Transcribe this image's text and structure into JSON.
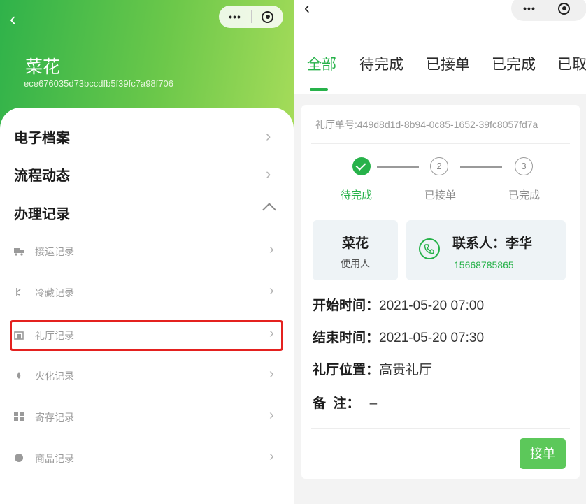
{
  "left": {
    "back_glyph": "‹",
    "user_name": "菜花",
    "user_id": "ece676035d73bccdfb5f39fc7a98f706",
    "menu": [
      {
        "label": "电子档案",
        "chevron": "›"
      },
      {
        "label": "流程动态",
        "chevron": "›"
      },
      {
        "label": "办理记录"
      }
    ],
    "records": [
      {
        "label": "接运记录",
        "icon": "truck-icon",
        "chevron": "›"
      },
      {
        "label": "冷藏记录",
        "icon": "snowflake-icon",
        "chevron": "›"
      },
      {
        "label": "礼厅记录",
        "icon": "hall-icon",
        "chevron": "›"
      },
      {
        "label": "火化记录",
        "icon": "flame-icon",
        "chevron": "›"
      },
      {
        "label": "寄存记录",
        "icon": "storage-icon",
        "chevron": "›"
      },
      {
        "label": "商品记录",
        "icon": "goods-icon",
        "chevron": "›"
      }
    ],
    "highlight_color": "#e4211f"
  },
  "capsule": {
    "dots": "•••"
  },
  "right": {
    "back_glyph": "‹",
    "tabs": [
      "全部",
      "待完成",
      "已接单",
      "已完成",
      "已取"
    ],
    "active_tab": "全部",
    "order_no": "礼厅单号:449d8d1d-8b94-0c85-1652-39fc8057fd7a",
    "steps": [
      {
        "num": "",
        "label": "待完成",
        "state": "done"
      },
      {
        "num": "2",
        "label": "已接单",
        "state": "todo"
      },
      {
        "num": "3",
        "label": "已完成",
        "state": "todo"
      }
    ],
    "user_box": {
      "name": "菜花",
      "role": "使用人"
    },
    "contact": {
      "label": "联系人：李华",
      "phone": "15668785865"
    },
    "info": [
      {
        "label": "开始时间：",
        "value": "2021-05-20 07:00"
      },
      {
        "label": "结束时间：",
        "value": "2021-05-20 07:30"
      },
      {
        "label": "礼厅位置：",
        "value": "高贵礼厅"
      },
      {
        "label": "备  注：",
        "value": "–"
      }
    ],
    "accept_label": "接单",
    "accent_color": "#27b24a"
  }
}
